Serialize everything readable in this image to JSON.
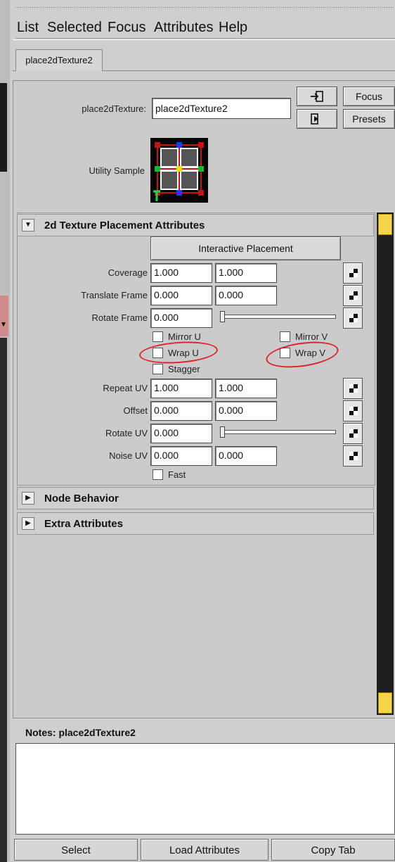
{
  "menu": [
    "List",
    "Selected",
    "Focus",
    "Attributes",
    "Help"
  ],
  "tab": "place2dTexture2",
  "header": {
    "node_label": "place2dTexture:",
    "node_value": "place2dTexture2",
    "focus_label": "Focus",
    "presets_label": "Presets",
    "utility_sample_label": "Utility Sample"
  },
  "section": {
    "title": "2d Texture Placement Attributes",
    "interactive_placement": "Interactive Placement",
    "rows": [
      {
        "label": "Coverage",
        "v1": "1.000",
        "v2": "1.000"
      },
      {
        "label": "Translate Frame",
        "v1": "0.000",
        "v2": "0.000"
      },
      {
        "label": "Rotate Frame",
        "v1": "0.000"
      },
      {
        "label": "Repeat UV",
        "v1": "1.000",
        "v2": "1.000"
      },
      {
        "label": "Offset",
        "v1": "0.000",
        "v2": "0.000"
      },
      {
        "label": "Rotate UV",
        "v1": "0.000"
      },
      {
        "label": "Noise UV",
        "v1": "0.000",
        "v2": "0.000"
      }
    ],
    "checkboxes": {
      "mirror_u": "Mirror U",
      "mirror_v": "Mirror V",
      "wrap_u": "Wrap U",
      "wrap_v": "Wrap V",
      "stagger": "Stagger",
      "fast": "Fast"
    }
  },
  "collapsed_sections": [
    "Node Behavior",
    "Extra Attributes"
  ],
  "notes_label": "Notes:  place2dTexture2",
  "bottom_buttons": [
    "Select",
    "Load Attributes",
    "Copy Tab"
  ],
  "colors": {
    "scroll_handle": "#f5d54a",
    "annotation": "#e0242e"
  }
}
